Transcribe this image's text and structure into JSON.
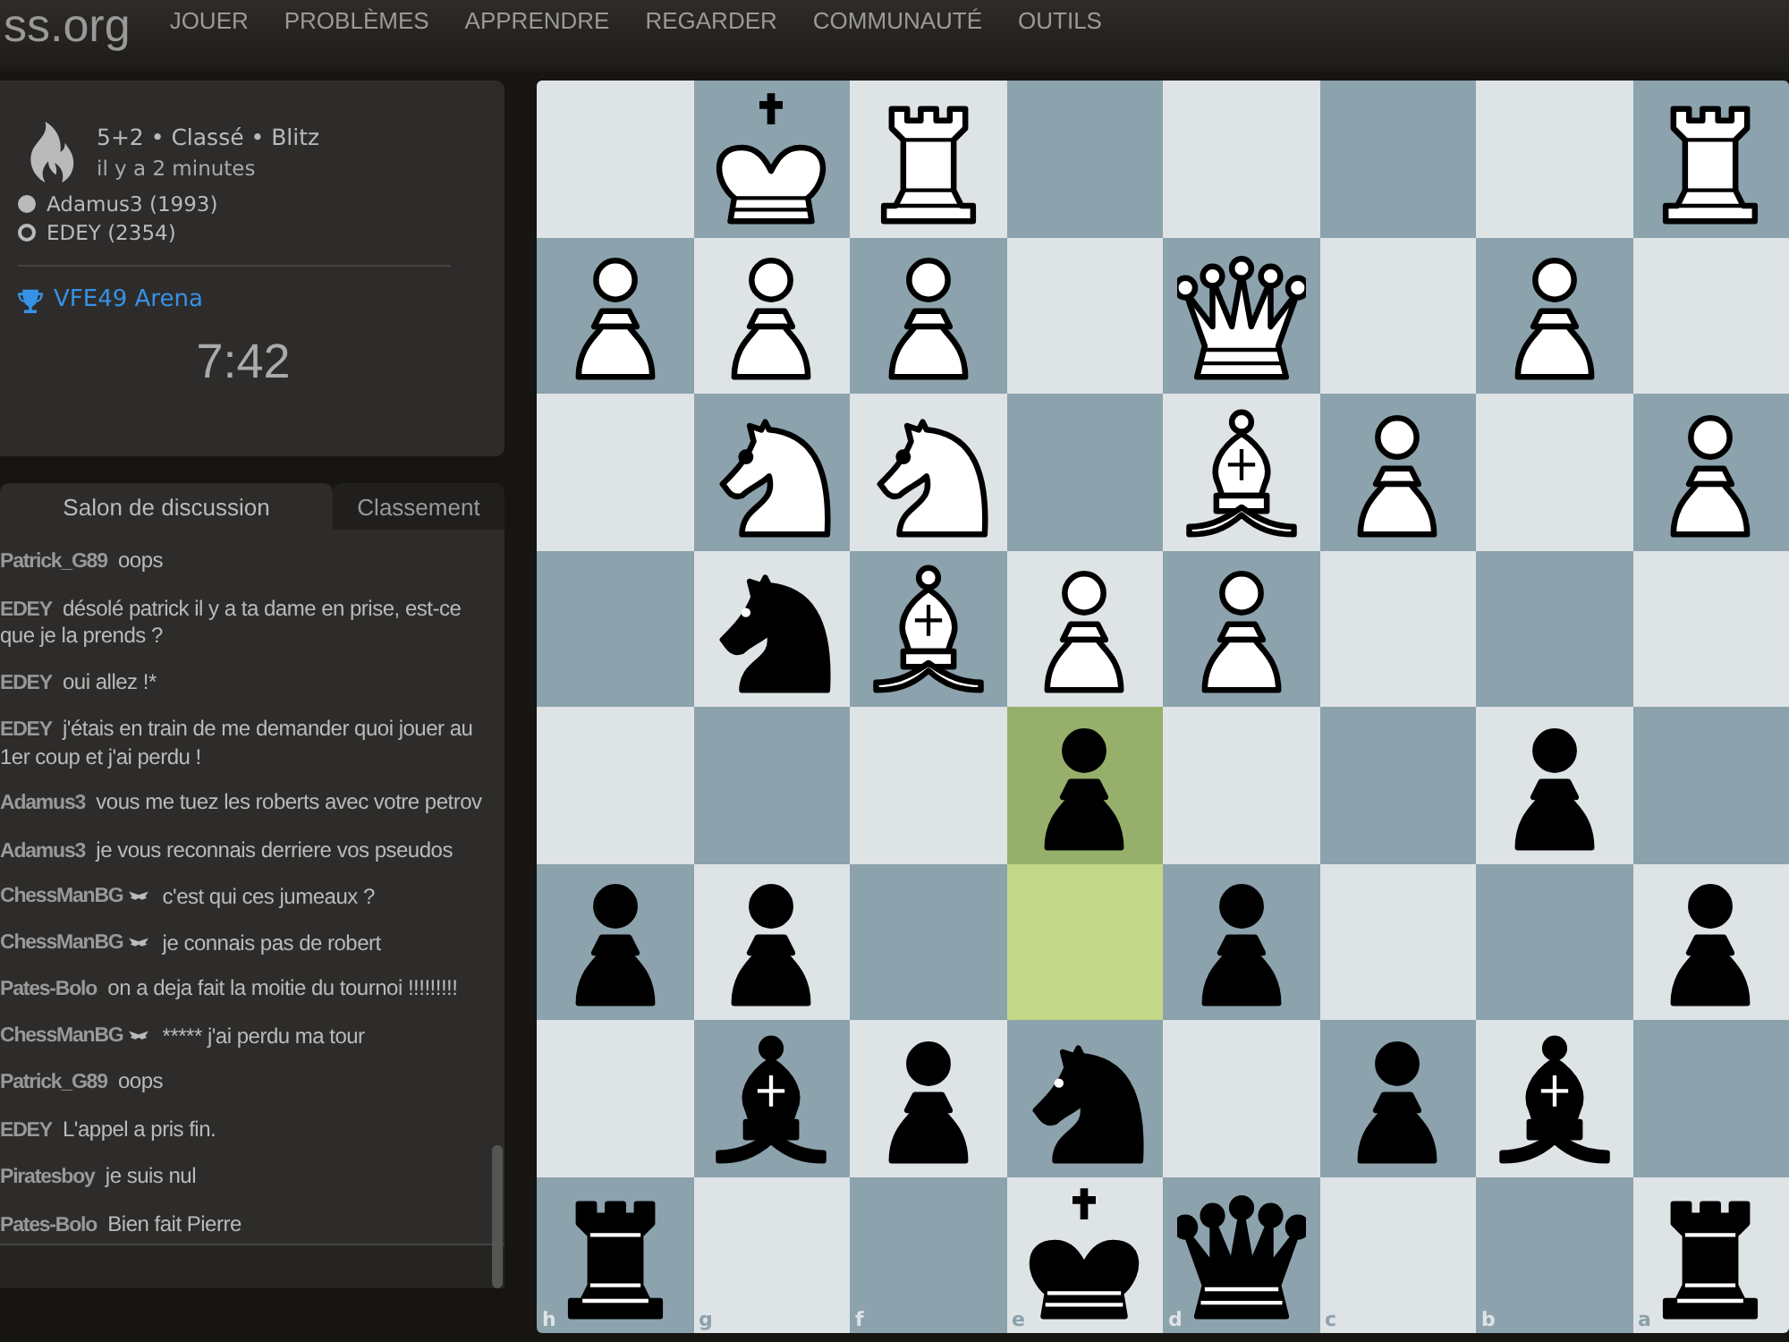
{
  "header": {
    "logo": "ss.org",
    "nav": [
      "JOUER",
      "PROBLÈMES",
      "APPRENDRE",
      "REGARDER",
      "COMMUNAUTÉ",
      "OUTILS"
    ]
  },
  "game_info": {
    "title": "5+2 • Classé • Blitz",
    "time_ago": "il y a 2 minutes",
    "players": [
      {
        "name": "Adamus3 (1993)",
        "kind": "filled"
      },
      {
        "name": "EDEY (2354)",
        "kind": "outline"
      }
    ],
    "tournament": "VFE49 Arena",
    "clock": "7:42"
  },
  "tabs": [
    {
      "label": "Salon de discussion",
      "selected": true
    },
    {
      "label": "Classement",
      "selected": false
    }
  ],
  "chat": [
    {
      "user": "Patrick_G89",
      "patron": false,
      "text": "oops"
    },
    {
      "user": "EDEY",
      "patron": false,
      "text": "désolé patrick il y a ta dame en prise, est-ce que je la prends ?"
    },
    {
      "user": "EDEY",
      "patron": false,
      "text": "oui allez !*"
    },
    {
      "user": "EDEY",
      "patron": false,
      "text": "j'étais en train de me demander quoi jouer au 1er coup et j'ai perdu !"
    },
    {
      "user": "Adamus3",
      "patron": false,
      "text": "vous me tuez les roberts avec votre petrov"
    },
    {
      "user": "Adamus3",
      "patron": false,
      "text": "je vous reconnais derriere vos pseudos"
    },
    {
      "user": "ChessManBG",
      "patron": true,
      "text": "c'est qui ces jumeaux ?"
    },
    {
      "user": "ChessManBG",
      "patron": true,
      "text": "je connais pas de robert"
    },
    {
      "user": "Pates-Bolo",
      "patron": false,
      "text": "on a deja fait la moitie du tournoi !!!!!!!!!"
    },
    {
      "user": "ChessManBG",
      "patron": true,
      "text": "***** j'ai perdu ma tour"
    },
    {
      "user": "Patrick_G89",
      "patron": false,
      "text": "oops"
    },
    {
      "user": "EDEY",
      "patron": false,
      "text": "L'appel a pris fin."
    },
    {
      "user": "Piratesboy",
      "patron": false,
      "text": "je suis nul"
    },
    {
      "user": "Pates-Bolo",
      "patron": false,
      "text": "Bien fait Pierre"
    }
  ],
  "board": {
    "rows": [
      [
        null,
        {
          "kind": "king",
          "color": "#ffffff",
          "highlighted": false
        },
        {
          "kind": "rook",
          "color": "#ffffff",
          "highlighted": false
        },
        null,
        null,
        null,
        null,
        {
          "kind": "rook",
          "color": "#ffffff",
          "highlighted": false
        }
      ],
      [
        {
          "kind": "pawn",
          "color": "#ffffff",
          "highlighted": false
        },
        {
          "kind": "pawn",
          "color": "#ffffff",
          "highlighted": false
        },
        {
          "kind": "pawn",
          "color": "#ffffff",
          "highlighted": false
        },
        null,
        {
          "kind": "queen",
          "color": "#ffffff",
          "highlighted": false
        },
        null,
        {
          "kind": "pawn",
          "color": "#ffffff",
          "highlighted": false
        },
        null
      ],
      [
        null,
        {
          "kind": "knight",
          "color": "#ffffff",
          "highlighted": false
        },
        {
          "kind": "knight",
          "color": "#ffffff",
          "highlighted": false
        },
        null,
        {
          "kind": "bishop",
          "color": "#ffffff",
          "highlighted": false
        },
        {
          "kind": "pawn",
          "color": "#ffffff",
          "highlighted": false
        },
        null,
        {
          "kind": "pawn",
          "color": "#ffffff",
          "highlighted": false
        }
      ],
      [
        null,
        {
          "kind": "knight",
          "color": "#000000",
          "highlighted": false
        },
        {
          "kind": "bishop",
          "color": "#ffffff",
          "highlighted": false
        },
        {
          "kind": "pawn",
          "color": "#ffffff",
          "highlighted": false
        },
        {
          "kind": "pawn",
          "color": "#ffffff",
          "highlighted": false
        },
        null,
        null,
        null
      ],
      [
        null,
        null,
        null,
        {
          "kind": "pawn",
          "color": "#000000",
          "highlighted": true
        },
        null,
        null,
        {
          "kind": "pawn",
          "color": "#000000",
          "highlighted": false
        },
        null
      ],
      [
        {
          "kind": "pawn",
          "color": "#000000",
          "highlighted": false
        },
        {
          "kind": "pawn",
          "color": "#000000",
          "highlighted": false
        },
        null,
        {
          "highlighted": true
        },
        {
          "kind": "pawn",
          "color": "#000000",
          "highlighted": false
        },
        null,
        null,
        {
          "kind": "pawn",
          "color": "#000000",
          "highlighted": false
        }
      ],
      [
        null,
        {
          "kind": "bishop",
          "color": "#000000",
          "highlighted": false
        },
        {
          "kind": "pawn",
          "color": "#000000",
          "highlighted": false
        },
        {
          "kind": "knight",
          "color": "#000000",
          "highlighted": false
        },
        null,
        {
          "kind": "pawn",
          "color": "#000000",
          "highlighted": false
        },
        {
          "kind": "bishop",
          "color": "#000000",
          "highlighted": false
        },
        null
      ],
      [
        {
          "kind": "rook",
          "color": "#000000",
          "highlighted": false
        },
        null,
        null,
        {
          "kind": "king",
          "color": "#000000",
          "highlighted": false
        },
        {
          "kind": "queen",
          "color": "#000000",
          "highlighted": false
        },
        null,
        null,
        {
          "kind": "rook",
          "color": "#000000",
          "highlighted": false
        }
      ]
    ],
    "files": [
      "h",
      "g",
      "f",
      "e",
      "d",
      "c",
      "b",
      "a"
    ]
  }
}
